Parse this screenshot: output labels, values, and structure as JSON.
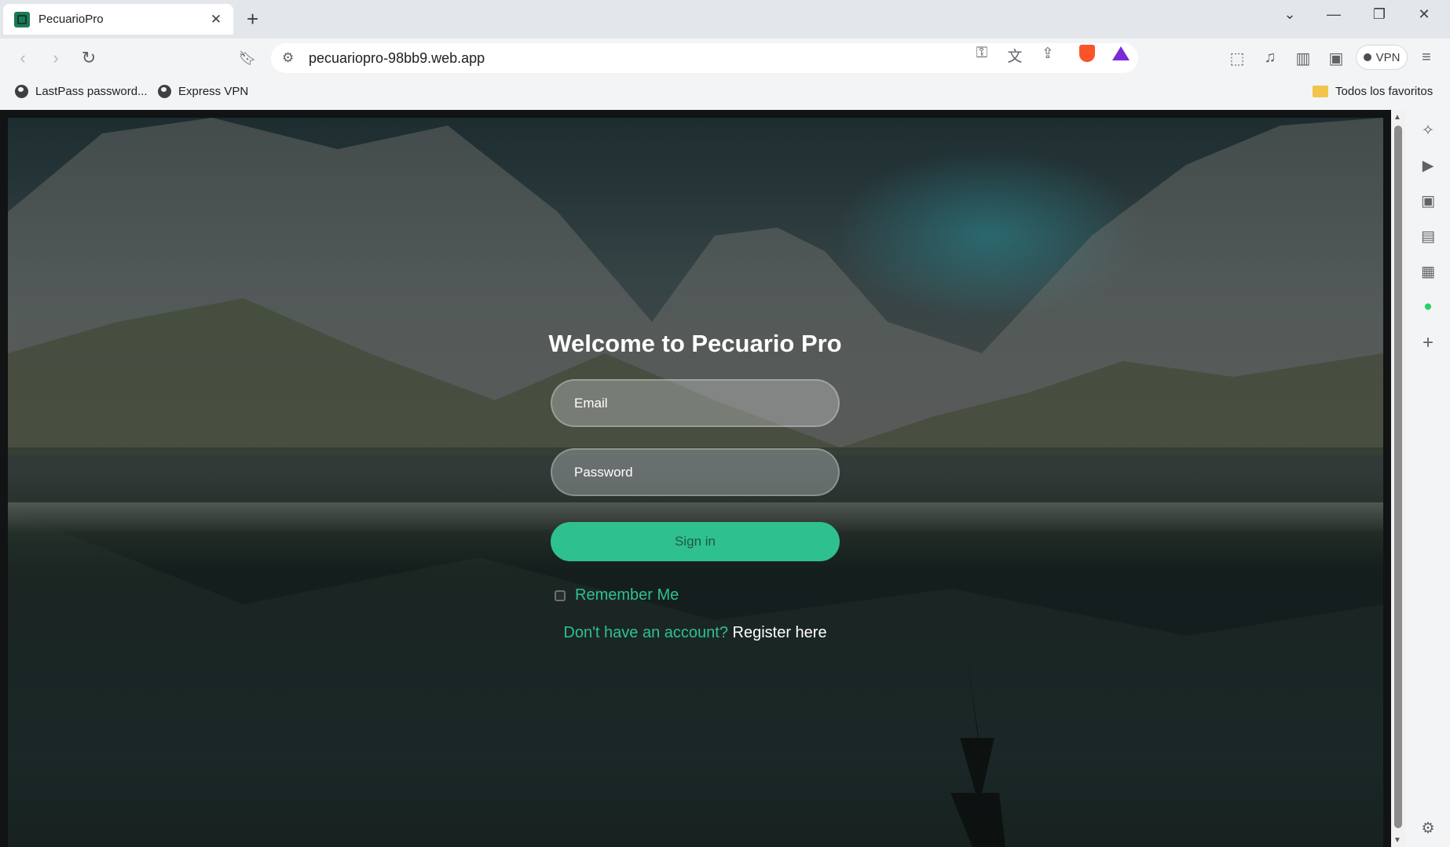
{
  "browser": {
    "tab": {
      "title": "PecuarioPro",
      "close": "✕"
    },
    "new_tab": "+",
    "window_controls": {
      "list": "⌄",
      "minimize": "—",
      "restore": "❐",
      "close": "✕"
    },
    "url": "pecuariopro-98bb9.web.app",
    "vpn_label": "VPN",
    "bookmarks": [
      {
        "label": "LastPass password...",
        "icon": "globe-icon"
      },
      {
        "label": "Express VPN",
        "icon": "globe-icon"
      }
    ],
    "all_bookmarks": "Todos los favoritos"
  },
  "login": {
    "title": "Welcome to Pecuario Pro",
    "email_placeholder": "Email",
    "password_placeholder": "Password",
    "signin_label": "Sign in",
    "remember_label": "Remember Me",
    "register_question": "Don't have an account?",
    "register_link": "Register here"
  },
  "colors": {
    "accent": "#2fc08f",
    "title_text": "#ffffff"
  }
}
